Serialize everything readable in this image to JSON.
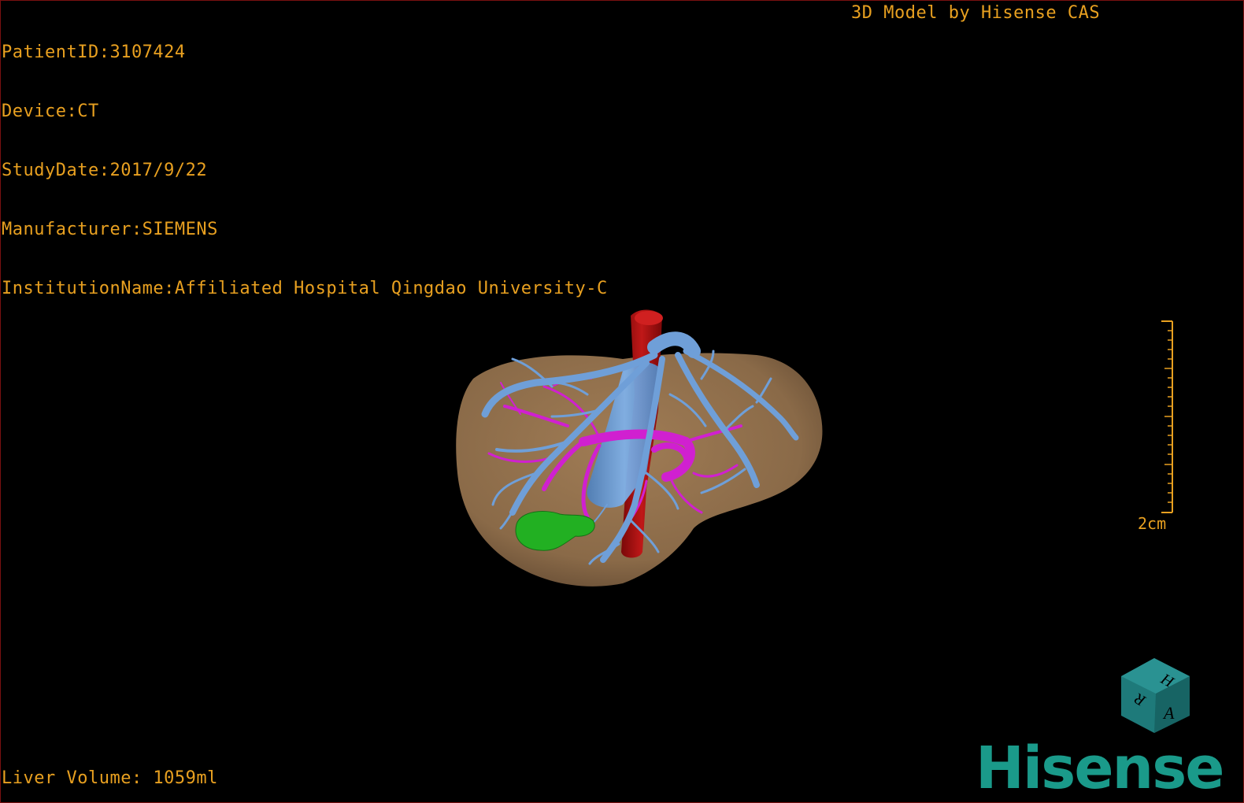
{
  "study_info": {
    "patient_id": "PatientID:3107424",
    "device": "Device:CT",
    "study_date": "StudyDate:2017/9/22",
    "manufacturer": "Manufacturer:SIEMENS",
    "institution": "InstitutionName:Affiliated Hospital Qingdao University-C"
  },
  "model_credit": "3D Model by Hisense CAS",
  "liver_volume": "Liver Volume: 1059ml",
  "scale_bar": {
    "label": "2cm"
  },
  "orientation_cube": {
    "faces": [
      "H",
      "R",
      "A"
    ],
    "color": "#1e7a7a"
  },
  "brand": {
    "name": "Hisense",
    "color": "#1a9a8a"
  },
  "model": {
    "liver_color": "#8a6a48",
    "hepatic_vein_color": "#6f9fd8",
    "portal_vein_color": "#d020d0",
    "artery_color": "#b01010",
    "gallbladder_color": "#20b020"
  },
  "text_color": "#e8a020",
  "background": "#000000"
}
